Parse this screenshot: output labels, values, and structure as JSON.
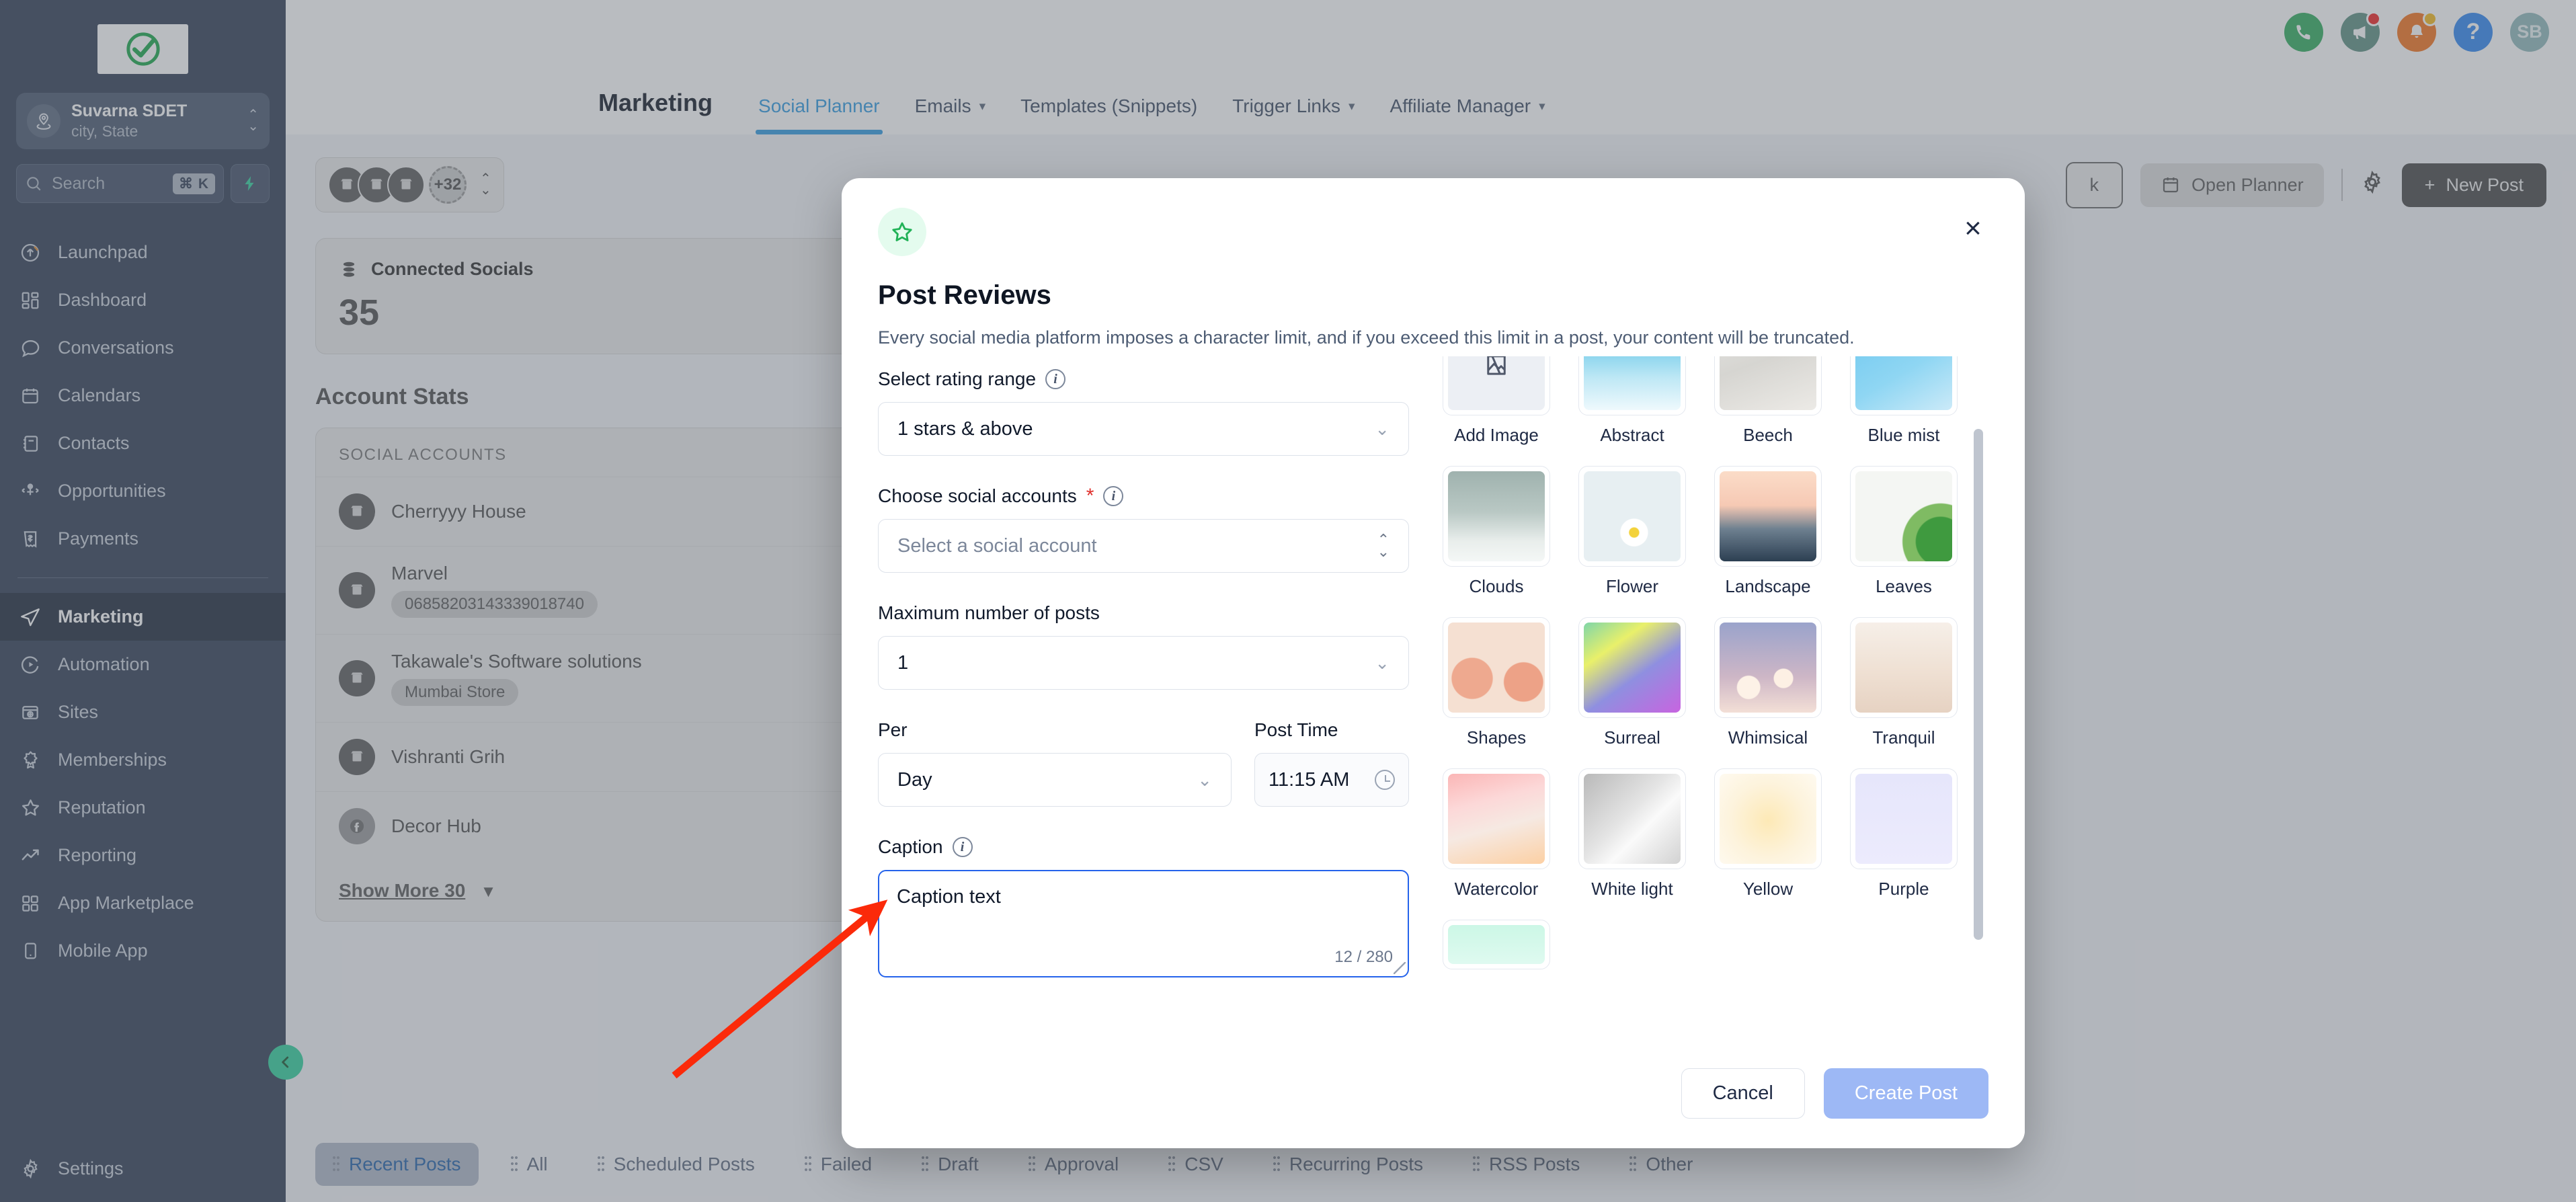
{
  "sidebar": {
    "location": {
      "name": "Suvarna SDET",
      "sub": "city, State"
    },
    "search": {
      "placeholder": "Search",
      "shortcut": "⌘ K"
    },
    "items": [
      {
        "label": "Launchpad",
        "icon": "rocket-launch-icon"
      },
      {
        "label": "Dashboard",
        "icon": "dashboard-grid-icon"
      },
      {
        "label": "Conversations",
        "icon": "chat-bubble-icon"
      },
      {
        "label": "Calendars",
        "icon": "calendar-icon"
      },
      {
        "label": "Contacts",
        "icon": "contacts-book-icon"
      },
      {
        "label": "Opportunities",
        "icon": "opportunities-icon"
      },
      {
        "label": "Payments",
        "icon": "payments-invoice-icon"
      },
      {
        "label": "Marketing",
        "icon": "paper-plane-icon"
      },
      {
        "label": "Automation",
        "icon": "automation-play-icon"
      },
      {
        "label": "Sites",
        "icon": "sites-window-icon"
      },
      {
        "label": "Memberships",
        "icon": "membership-badge-icon"
      },
      {
        "label": "Reputation",
        "icon": "star-outline-icon"
      },
      {
        "label": "Reporting",
        "icon": "trend-up-icon"
      },
      {
        "label": "App Marketplace",
        "icon": "app-grid-icon"
      },
      {
        "label": "Mobile App",
        "icon": "mobile-phone-icon"
      }
    ],
    "active_item": "Marketing",
    "settings_label": "Settings"
  },
  "topbar": {
    "icons": [
      {
        "name": "phone-icon",
        "color": "#2eab5b"
      },
      {
        "name": "megaphone-icon",
        "color": "#5b8f80",
        "badge": "#f01f1f"
      },
      {
        "name": "bell-icon",
        "color": "#f5711a",
        "badge": "#f5b91a"
      },
      {
        "name": "help-question-icon",
        "color": "#2f86f0"
      }
    ],
    "avatar_initials": "SB"
  },
  "navbar": {
    "title": "Marketing",
    "tabs": [
      {
        "label": "Social Planner",
        "has_caret": false,
        "active": true
      },
      {
        "label": "Emails",
        "has_caret": true,
        "active": false
      },
      {
        "label": "Templates (Snippets)",
        "has_caret": false,
        "active": false
      },
      {
        "label": "Trigger Links",
        "has_caret": true,
        "active": false
      },
      {
        "label": "Affiliate Manager",
        "has_caret": true,
        "active": false
      }
    ]
  },
  "toolbar": {
    "overflow_count": "+32",
    "bulk_label": "k",
    "open_planner_label": "Open Planner",
    "gear_icon": "gear-icon",
    "new_post_label": "New Post"
  },
  "stats": {
    "connected_socials_label": "Connected Socials",
    "connected_socials_value": "35",
    "section_title": "Account Stats",
    "panel_header": "SOCIAL ACCOUNTS",
    "accounts": [
      {
        "name": "Cherryyy House",
        "chip": ""
      },
      {
        "name": "Marvel",
        "chip": "06858203143339018740"
      },
      {
        "name": "Takawale's Software solutions",
        "chip": "Mumbai Store"
      },
      {
        "name": "Vishranti Grih",
        "chip": ""
      },
      {
        "name": "Decor Hub",
        "chip": ""
      }
    ],
    "show_more_label": "Show More 30"
  },
  "post_tabs": [
    {
      "label": "Recent Posts",
      "active": true
    },
    {
      "label": "All",
      "active": false
    },
    {
      "label": "Scheduled Posts",
      "active": false
    },
    {
      "label": "Failed",
      "active": false
    },
    {
      "label": "Draft",
      "active": false
    },
    {
      "label": "Approval",
      "active": false
    },
    {
      "label": "CSV",
      "active": false
    },
    {
      "label": "Recurring Posts",
      "active": false
    },
    {
      "label": "RSS Posts",
      "active": false
    },
    {
      "label": "Other",
      "active": false
    }
  ],
  "modal": {
    "icon": "star-outline-icon",
    "title": "Post Reviews",
    "subtitle": "Every social media platform imposes a character limit, and if you exceed this limit in a post, your content will be truncated.",
    "close_icon": "close-icon",
    "fields": {
      "rating_label": "Select rating range",
      "rating_value": "1 stars & above",
      "accounts_label": "Choose social accounts",
      "accounts_placeholder": "Select a social account",
      "max_posts_label": "Maximum number of posts",
      "max_posts_value": "1",
      "per_label": "Per",
      "per_value": "Day",
      "post_time_label": "Post Time",
      "post_time_value": "11:15 AM",
      "caption_label": "Caption",
      "caption_value": "Caption text",
      "caption_counter": "12 / 280"
    },
    "gallery": [
      {
        "label": "Add Image",
        "kind": "add"
      },
      {
        "label": "Abstract",
        "kind": "image"
      },
      {
        "label": "Beech",
        "kind": "image"
      },
      {
        "label": "Blue mist",
        "kind": "image"
      },
      {
        "label": "Clouds",
        "kind": "image"
      },
      {
        "label": "Flower",
        "kind": "image"
      },
      {
        "label": "Landscape",
        "kind": "image"
      },
      {
        "label": "Leaves",
        "kind": "image"
      },
      {
        "label": "Shapes",
        "kind": "image"
      },
      {
        "label": "Surreal",
        "kind": "image"
      },
      {
        "label": "Whimsical",
        "kind": "image"
      },
      {
        "label": "Tranquil",
        "kind": "image"
      },
      {
        "label": "Watercolor",
        "kind": "image"
      },
      {
        "label": "White light",
        "kind": "image"
      },
      {
        "label": "Yellow",
        "kind": "image"
      },
      {
        "label": "Purple",
        "kind": "image"
      }
    ],
    "cancel_label": "Cancel",
    "create_label": "Create Post"
  },
  "colors": {
    "sidebar_bg": "#2e3b52",
    "accent_blue": "#2e9ae0",
    "primary_blue": "#1644a8",
    "create_btn": "#9db8f5",
    "annotation_red": "#fb2a0a",
    "focus_blue": "#2563eb",
    "chip_green": "#c7e3c9"
  }
}
